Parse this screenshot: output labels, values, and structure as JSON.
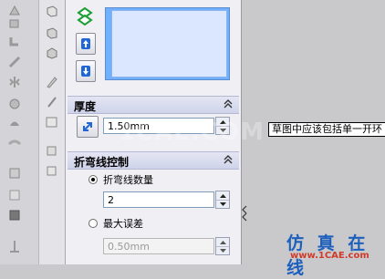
{
  "thickness": {
    "title": "厚度",
    "value": "1.50mm"
  },
  "bend_control": {
    "title": "折弯线控制",
    "option_count_label": "折弯线数量",
    "count_value": "2",
    "option_error_label": "最大误差",
    "error_value": "0.50mm",
    "selected": "count"
  },
  "tooltip": {
    "text": "草图中应该包括单一开环"
  },
  "watermark": {
    "text": "1CAE.COM"
  },
  "brand": {
    "name": "仿 真 在 线",
    "url": "www.1CAE.com"
  },
  "icons": {
    "strip": [
      "tool-icon-1",
      "tool-icon-2",
      "tool-icon-3",
      "tool-icon-4",
      "tool-icon-5",
      "tool-icon-6",
      "tool-icon-7",
      "tool-icon-8",
      "tool-icon-9",
      "tool-icon-10",
      "tool-icon-11",
      "tool-icon-12"
    ],
    "panel": [
      "move-up-icon",
      "move-down-icon",
      "direction-icon",
      "green-chevron-icon"
    ]
  },
  "colors": {
    "accent_blue": "#6fb0ff",
    "header_bg": "#cfd3ea",
    "brand_blue": "#1c5fbd",
    "url_red": "#d03b2a"
  }
}
